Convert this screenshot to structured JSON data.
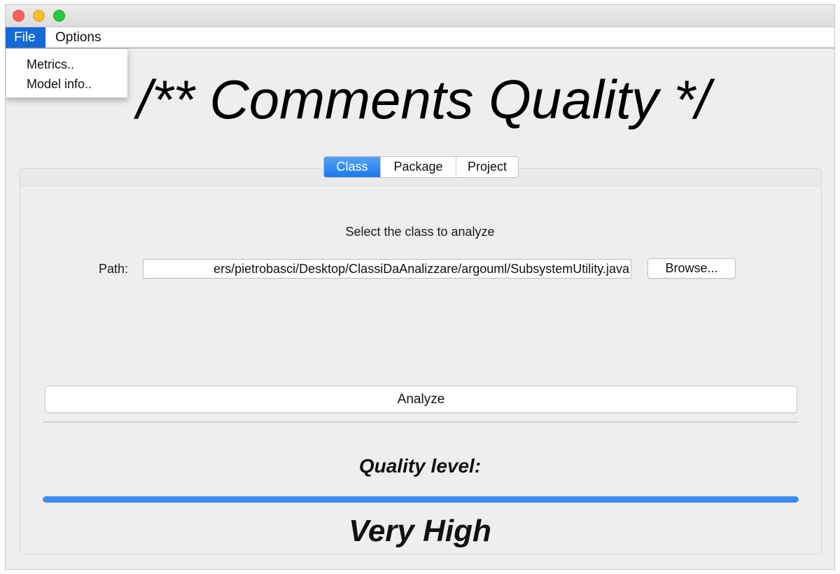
{
  "menubar": {
    "items": [
      "File",
      "Options"
    ]
  },
  "file_menu": {
    "items": [
      "Metrics..",
      "Model info.."
    ]
  },
  "main": {
    "title": "/** Comments Quality */",
    "tabs": [
      "Class",
      "Package",
      "Project"
    ],
    "active_tab": "Class",
    "select_prompt": "Select the class to analyze",
    "path_label": "Path:",
    "path_value": "ers/pietrobasci/Desktop/ClassiDaAnalizzare/argouml/SubsystemUtility.java",
    "browse_label": "Browse...",
    "analyze_label": "Analyze",
    "quality_label": "Quality level:",
    "quality_value": "Very High",
    "quality_progress": 1.0
  },
  "colors": {
    "accent": "#1b78ee",
    "progress": "#3a8ef0",
    "close": "#fc5f57",
    "minimize": "#fdbc2e",
    "maximize": "#28c840"
  }
}
